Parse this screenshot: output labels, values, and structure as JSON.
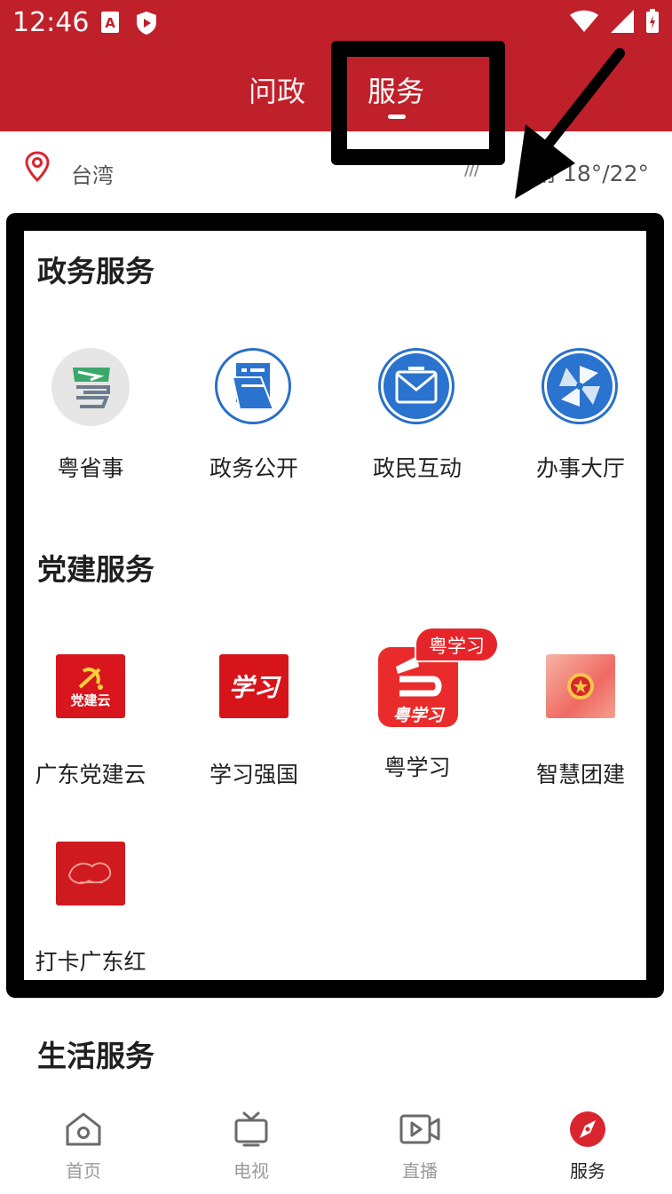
{
  "status_bar": {
    "time": "12:46",
    "left_icons": [
      "font-a-icon",
      "shield-icon"
    ],
    "right_icons": [
      "wifi-icon",
      "signal-icon",
      "battery-charging-icon"
    ]
  },
  "header": {
    "tabs": [
      {
        "label": "问政",
        "active": false
      },
      {
        "label": "服务",
        "active": true
      }
    ],
    "accent_color": "#c0202a"
  },
  "location": {
    "city": "台湾",
    "weather_icon": "rain-icon",
    "weather_glyph": "///",
    "weather_text": "雨 18°/22°"
  },
  "sections": [
    {
      "title": "政务服务",
      "items": [
        {
          "label": "粤省事",
          "icon": "yueshengshi-icon"
        },
        {
          "label": "政务公开",
          "icon": "document-icon"
        },
        {
          "label": "政民互动",
          "icon": "mail-icon"
        },
        {
          "label": "办事大厅",
          "icon": "pinwheel-icon"
        }
      ]
    },
    {
      "title": "党建服务",
      "items": [
        {
          "label": "广东党建云",
          "icon": "dangjianyun-icon",
          "icon_text": "党建云"
        },
        {
          "label": "学习强国",
          "icon": "xuexiqiangguo-icon",
          "icon_text": "学习"
        },
        {
          "label": "粤学习",
          "icon": "yuexuexi-icon",
          "icon_text": "粤学习",
          "badge": "粤学习"
        },
        {
          "label": "智慧团建",
          "icon": "tuanjian-icon"
        },
        {
          "label": "打卡广东红",
          "icon": "dakaguangdonghong-icon"
        }
      ]
    },
    {
      "title": "生活服务",
      "items": []
    }
  ],
  "bottom_nav": [
    {
      "label": "首页",
      "icon": "home-icon",
      "active": false
    },
    {
      "label": "电视",
      "icon": "tv-icon",
      "active": false
    },
    {
      "label": "直播",
      "icon": "live-video-icon",
      "active": false
    },
    {
      "label": "服务",
      "icon": "compass-icon",
      "active": true
    }
  ]
}
